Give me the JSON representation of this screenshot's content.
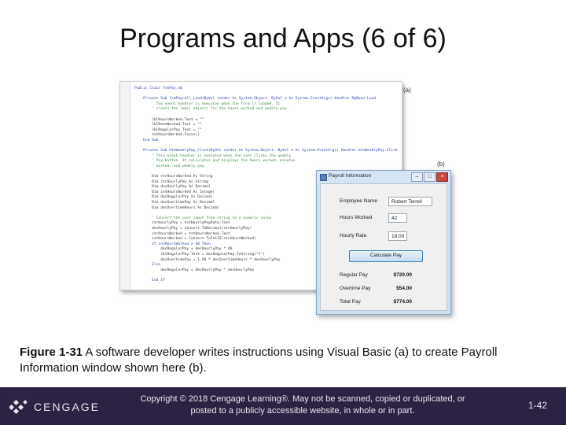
{
  "slide": {
    "title": "Programs and Apps (6 of 6)"
  },
  "figure": {
    "label_a": "(a)",
    "label_b": "(b)",
    "code_lines": [
      {
        "text": "Public Class frmPay.vb",
        "kind": "kw"
      },
      {
        "text": "",
        "kind": "code"
      },
      {
        "text": "    Private Sub frmPayroll_Load(ByVal sender As System.Object, ByVal e As System.EventArgs) Handles MyBase.Load",
        "kind": "kw"
      },
      {
        "text": "        ' The event handler is executed when the form is loaded. It",
        "kind": "cm"
      },
      {
        "text": "        ' clears the label objects for the hours worked and weekly pay.",
        "kind": "cm"
      },
      {
        "text": "",
        "kind": "code"
      },
      {
        "text": "        lblHoursWorked.Text = \"\"",
        "kind": "code"
      },
      {
        "text": "        lblRateWorked.Text = \"\"",
        "kind": "code"
      },
      {
        "text": "        lblRegularPay.Text = \"\"",
        "kind": "code"
      },
      {
        "text": "        txtHoursWorked.Focus()",
        "kind": "code"
      },
      {
        "text": "    End Sub",
        "kind": "kw"
      },
      {
        "text": "",
        "kind": "code"
      },
      {
        "text": "    Private Sub btnWeeklyPay_Click(ByVal sender As System.Object, ByVal e As System.EventArgs) Handles btnWeeklyPay.Click",
        "kind": "kw"
      },
      {
        "text": "        ' This event handler is executed when the user clicks the weekly",
        "kind": "cm"
      },
      {
        "text": "        ' Pay button. It calculates and displays the hours worked, minutes",
        "kind": "cm"
      },
      {
        "text": "        ' worked, and weekly pay.",
        "kind": "cm"
      },
      {
        "text": "",
        "kind": "code"
      },
      {
        "text": "        Dim strHoursWorked As String",
        "kind": "code"
      },
      {
        "text": "        Dim strHourlyPay As String",
        "kind": "code"
      },
      {
        "text": "        Dim decHourlyPay As Decimal",
        "kind": "code"
      },
      {
        "text": "        Dim intHoursWorked As Integer",
        "kind": "code"
      },
      {
        "text": "        Dim decRegularPay As Decimal",
        "kind": "code"
      },
      {
        "text": "        Dim decOvertimePay As Decimal",
        "kind": "code"
      },
      {
        "text": "        Dim decOvertimeHours As Decimal",
        "kind": "code"
      },
      {
        "text": "",
        "kind": "code"
      },
      {
        "text": "        ' Convert the user input from string to a numeric value",
        "kind": "cm"
      },
      {
        "text": "        strHourlyPay = txtHourlyPayRate.Text",
        "kind": "code"
      },
      {
        "text": "        decHourlyPay = Convert.ToDecimal(strHourlyPay)",
        "kind": "code"
      },
      {
        "text": "        strHoursWorked = txtHoursWorked.Text",
        "kind": "code"
      },
      {
        "text": "        intHoursWorked = Convert.ToInt32(strHoursWorked)",
        "kind": "code"
      },
      {
        "text": "        If intHoursWorked > 40 Then",
        "kind": "kw"
      },
      {
        "text": "            decRegularPay = decHourlyPay * 40",
        "kind": "code"
      },
      {
        "text": "            lblRegularPay.Text = decRegularPay.ToString(\"C\")",
        "kind": "code"
      },
      {
        "text": "            decOvertimePay = 1.50 * decOvertimeHours * decHourlyPay",
        "kind": "code"
      },
      {
        "text": "        Else",
        "kind": "kw"
      },
      {
        "text": "            decRegularPay = decHourlyPay * decHourlyPay",
        "kind": "code"
      },
      {
        "text": "",
        "kind": "code"
      },
      {
        "text": "        End If",
        "kind": "kw"
      }
    ]
  },
  "payroll_window": {
    "title": "Payroll Information",
    "controls": {
      "minimize": "–",
      "maximize": "□",
      "close": "×"
    },
    "employee_name_label": "Employee Name",
    "employee_name_value": "Robert Terrell",
    "hours_worked_label": "Hours Worked",
    "hours_worked_value": "42",
    "hourly_rate_label": "Hourly Rate",
    "hourly_rate_value": "18.00",
    "calculate_label": "Calculate Pay",
    "regular_pay_label": "Regular Pay",
    "regular_pay_value": "$720.00",
    "overtime_pay_label": "Overtime Pay",
    "overtime_pay_value": "$54.00",
    "total_pay_label": "Total Pay",
    "total_pay_value": "$774.00"
  },
  "caption": {
    "label": "Figure 1-31",
    "text": " A software developer writes instructions using Visual Basic (a) to create Payroll Information window shown here (b)."
  },
  "footer": {
    "logo_text": "CENGAGE",
    "copyright_line1": "Copyright © 2018 Cengage Learning®. May not be scanned, copied or duplicated, or",
    "copyright_line2": "posted to a publicly accessible website, in whole or in part.",
    "page_number": "1-42"
  },
  "colors": {
    "footer_bg": "#2b2341",
    "window_frame": "#cfe0f1",
    "keyword": "#2b3fb0",
    "comment": "#3d8a3d"
  }
}
